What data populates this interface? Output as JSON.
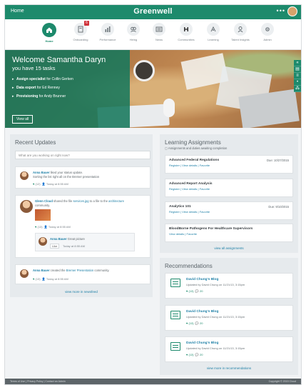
{
  "topbar": {
    "home": "Home",
    "brand": "Greenwell",
    "menu": "•••"
  },
  "nav": {
    "items": [
      {
        "label": "Home",
        "icon": "home-icon",
        "active": true
      },
      {
        "label": "Onboarding",
        "icon": "onboarding-icon",
        "badge": "6"
      },
      {
        "label": "Performance",
        "icon": "performance-icon"
      },
      {
        "label": "Hiring",
        "icon": "hiring-icon"
      },
      {
        "label": "News",
        "icon": "news-icon"
      },
      {
        "label": "Communities",
        "icon": "communities-icon"
      },
      {
        "label": "Learning",
        "icon": "learning-icon"
      },
      {
        "label": "Talent Insights",
        "icon": "talent-icon"
      },
      {
        "label": "Admin",
        "icon": "admin-icon"
      }
    ]
  },
  "hero": {
    "title": "Welcome Samantha Daryn",
    "subtitle": "you have 15 tasks",
    "tasks": [
      {
        "bold": "Assign specialist",
        "rest": " for Collin Gerken"
      },
      {
        "bold": "Data export",
        "rest": " for Ed Renney"
      },
      {
        "bold": "Provisioning",
        "rest": " for Andy Brunner"
      }
    ],
    "view_all": "View all"
  },
  "recent_updates": {
    "title": "Recent Updates",
    "search_placeholder": "What are you working on right now?",
    "posts": [
      {
        "name": "Anna Bauer",
        "text": " liked your status update.",
        "line2": "Sorting the list right all on the Bremer presentation",
        "likes": "(12)",
        "time": "Today at 8:55 AM"
      },
      {
        "name": "Glenn Cloud",
        "text": " shared the file ",
        "file": "services.jpg",
        "text2": " to a file to the ",
        "community": "architecture",
        "line2": "community.",
        "likes": "(13)",
        "time": "Today at 8:55 AM",
        "reply": {
          "name": "Anna Bauer",
          "text": " Great picture",
          "like": "Like",
          "time": "Today at 8:55 AM"
        }
      },
      {
        "name": "Anna Bauer",
        "text": " created the ",
        "link": "Bremer Presentation",
        "text2": " community.",
        "likes": "(13)",
        "time": "Today at 8:55 AM"
      }
    ],
    "footer": "view more in newsfeed"
  },
  "learning": {
    "title": "Learning Assignments",
    "subtitle": "Assignments and duties awaiting completion",
    "items": [
      {
        "title": "Advanced Federal Regulations",
        "due": "Due: 10/27/2015",
        "links": "Register | View details | Favorite"
      },
      {
        "title": "Advanced Report Analysis",
        "due": "",
        "links": "Register | View details | Favorite"
      },
      {
        "title": "Analytics 101",
        "due": "Due: 9/10/2015",
        "links": "Register | View details | Favorite"
      },
      {
        "title": "BloodBorne Pathogens For Healthcare Supervisors",
        "due": "",
        "links": "View details | Favorite"
      }
    ],
    "footer": "view all assignments"
  },
  "recommendations": {
    "title": "Recommendations",
    "items": [
      {
        "title": "David Chung's Blog",
        "sub": "Updated by David Chung on 11/21/13, 3:15pm",
        "likes": "(13)",
        "comments": "20"
      },
      {
        "title": "David Chung's Blog",
        "sub": "Updated by David Chung on 11/21/13, 3:15pm",
        "likes": "(13)",
        "comments": "20"
      },
      {
        "title": "David Chung's Blog",
        "sub": "Updated by David Chung on 11/21/13, 3:15pm",
        "likes": "(13)",
        "comments": "20"
      }
    ],
    "footer": "view more in recommendations"
  },
  "footer": {
    "left": "Terms of Use | Privacy Policy | Contact an Admin",
    "right": "Copyright © 2015 Cloud"
  },
  "colors": {
    "brand": "#1d8a6c",
    "link": "#1d7fa6",
    "badge": "#d0333b"
  }
}
